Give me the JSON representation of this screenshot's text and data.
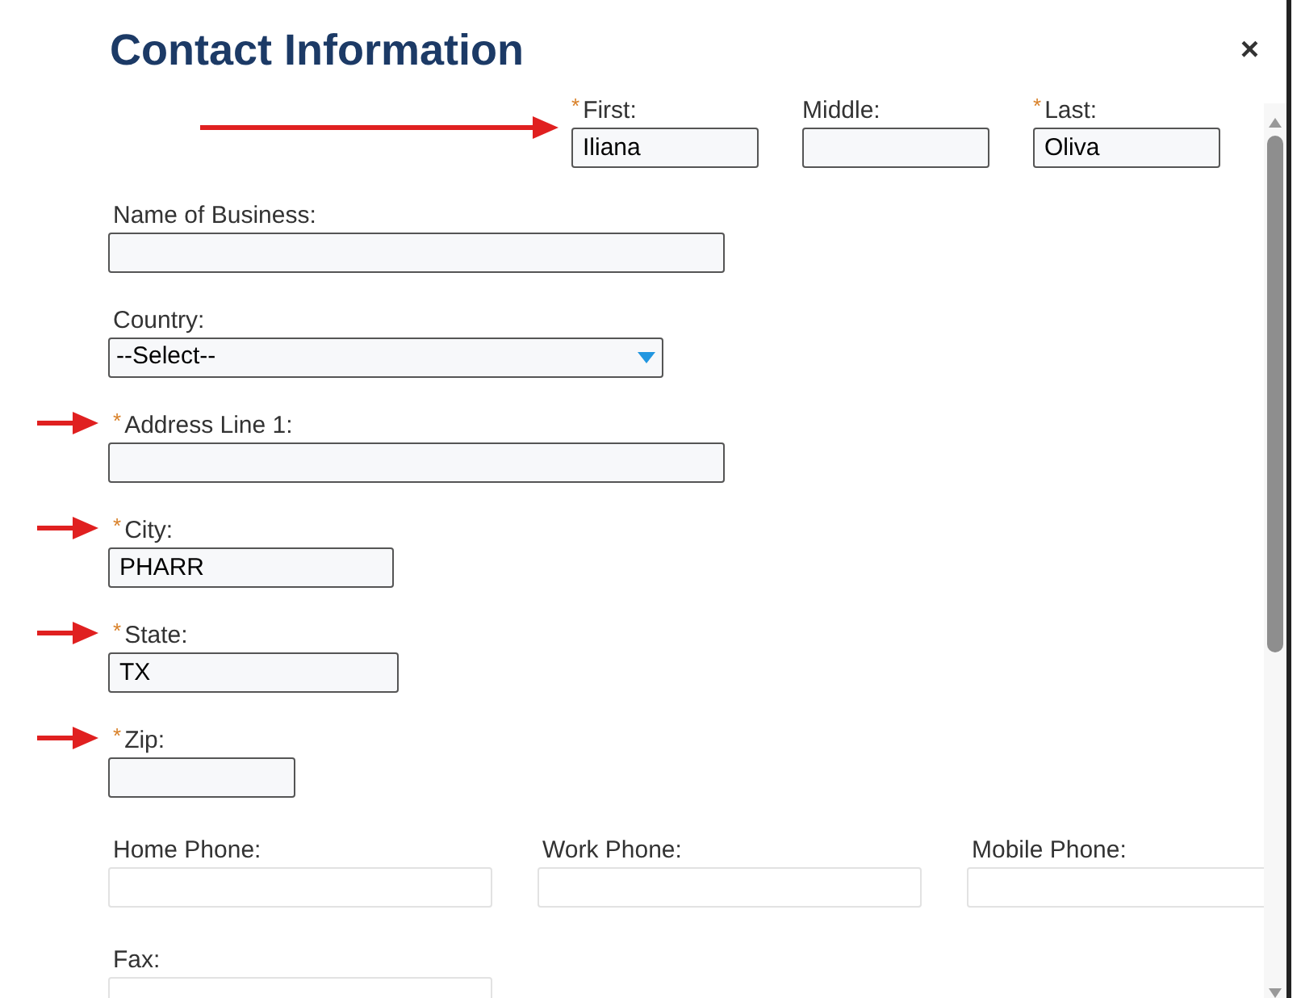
{
  "dialog": {
    "title": "Contact Information",
    "close": "×"
  },
  "name_row": {
    "marked": true,
    "fields": [
      {
        "label": "First:",
        "required_mark": "*",
        "value": "Iliana"
      },
      {
        "label": "Middle:"
      },
      {
        "label": "Last:",
        "required_mark": "*",
        "value": "Oliva"
      }
    ]
  },
  "fields": [
    {
      "kind": "text",
      "label": "Name of Business:",
      "marked": false
    },
    {
      "kind": "select",
      "label": "Country:",
      "value": "--Select--",
      "marked": false
    },
    {
      "kind": "text",
      "label": "Address Line 1:",
      "required_mark": "*",
      "marked": true
    },
    {
      "kind": "text",
      "label": "City:",
      "required_mark": "*",
      "value": "PHARR",
      "marked": true
    },
    {
      "kind": "text",
      "label": "State:",
      "required_mark": "*",
      "value": "TX",
      "marked": true
    },
    {
      "kind": "text",
      "label": "Zip:",
      "required_mark": "*",
      "marked": true
    }
  ],
  "phone_row": [
    {
      "label": "Home Phone:"
    },
    {
      "label": "Work Phone:"
    },
    {
      "label": "Mobile Phone:"
    }
  ],
  "fax": {
    "label": "Fax:"
  }
}
